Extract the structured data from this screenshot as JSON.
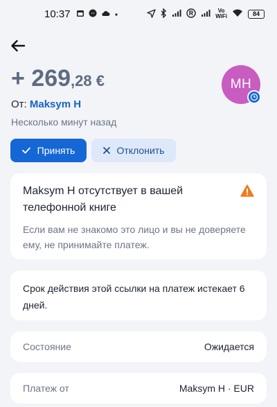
{
  "status_bar": {
    "time": "10:37",
    "battery": "84",
    "volte_top": "Vo",
    "volte_bottom": "WiFi"
  },
  "payment": {
    "amount_main": "+ 269",
    "amount_small": ",28 €",
    "from_prefix": "От: ",
    "from_name": "Maksym H",
    "time_ago": "Несколько минут назад",
    "avatar_initials": "MH",
    "avatar_color": "#c85cc0"
  },
  "actions": {
    "accept_label": "Принять",
    "decline_label": "Отклонить"
  },
  "warning": {
    "title": "Maksym H отсутствует в вашей телефонной книге",
    "text": "Если вам не знакомо это лицо и вы не доверяете ему, не принимайте платеж.",
    "icon": "warning-icon",
    "color": "#f07c1f"
  },
  "link_notice": {
    "text": "Срок действия этой ссылки на платеж истекает 6 дней."
  },
  "details": {
    "state_label": "Состояние",
    "state_value": "Ожидается",
    "from_label": "Платеж от",
    "from_value": "Maksym H · EUR"
  },
  "colors": {
    "accent": "#1567d6",
    "background": "#f3f4f8"
  }
}
